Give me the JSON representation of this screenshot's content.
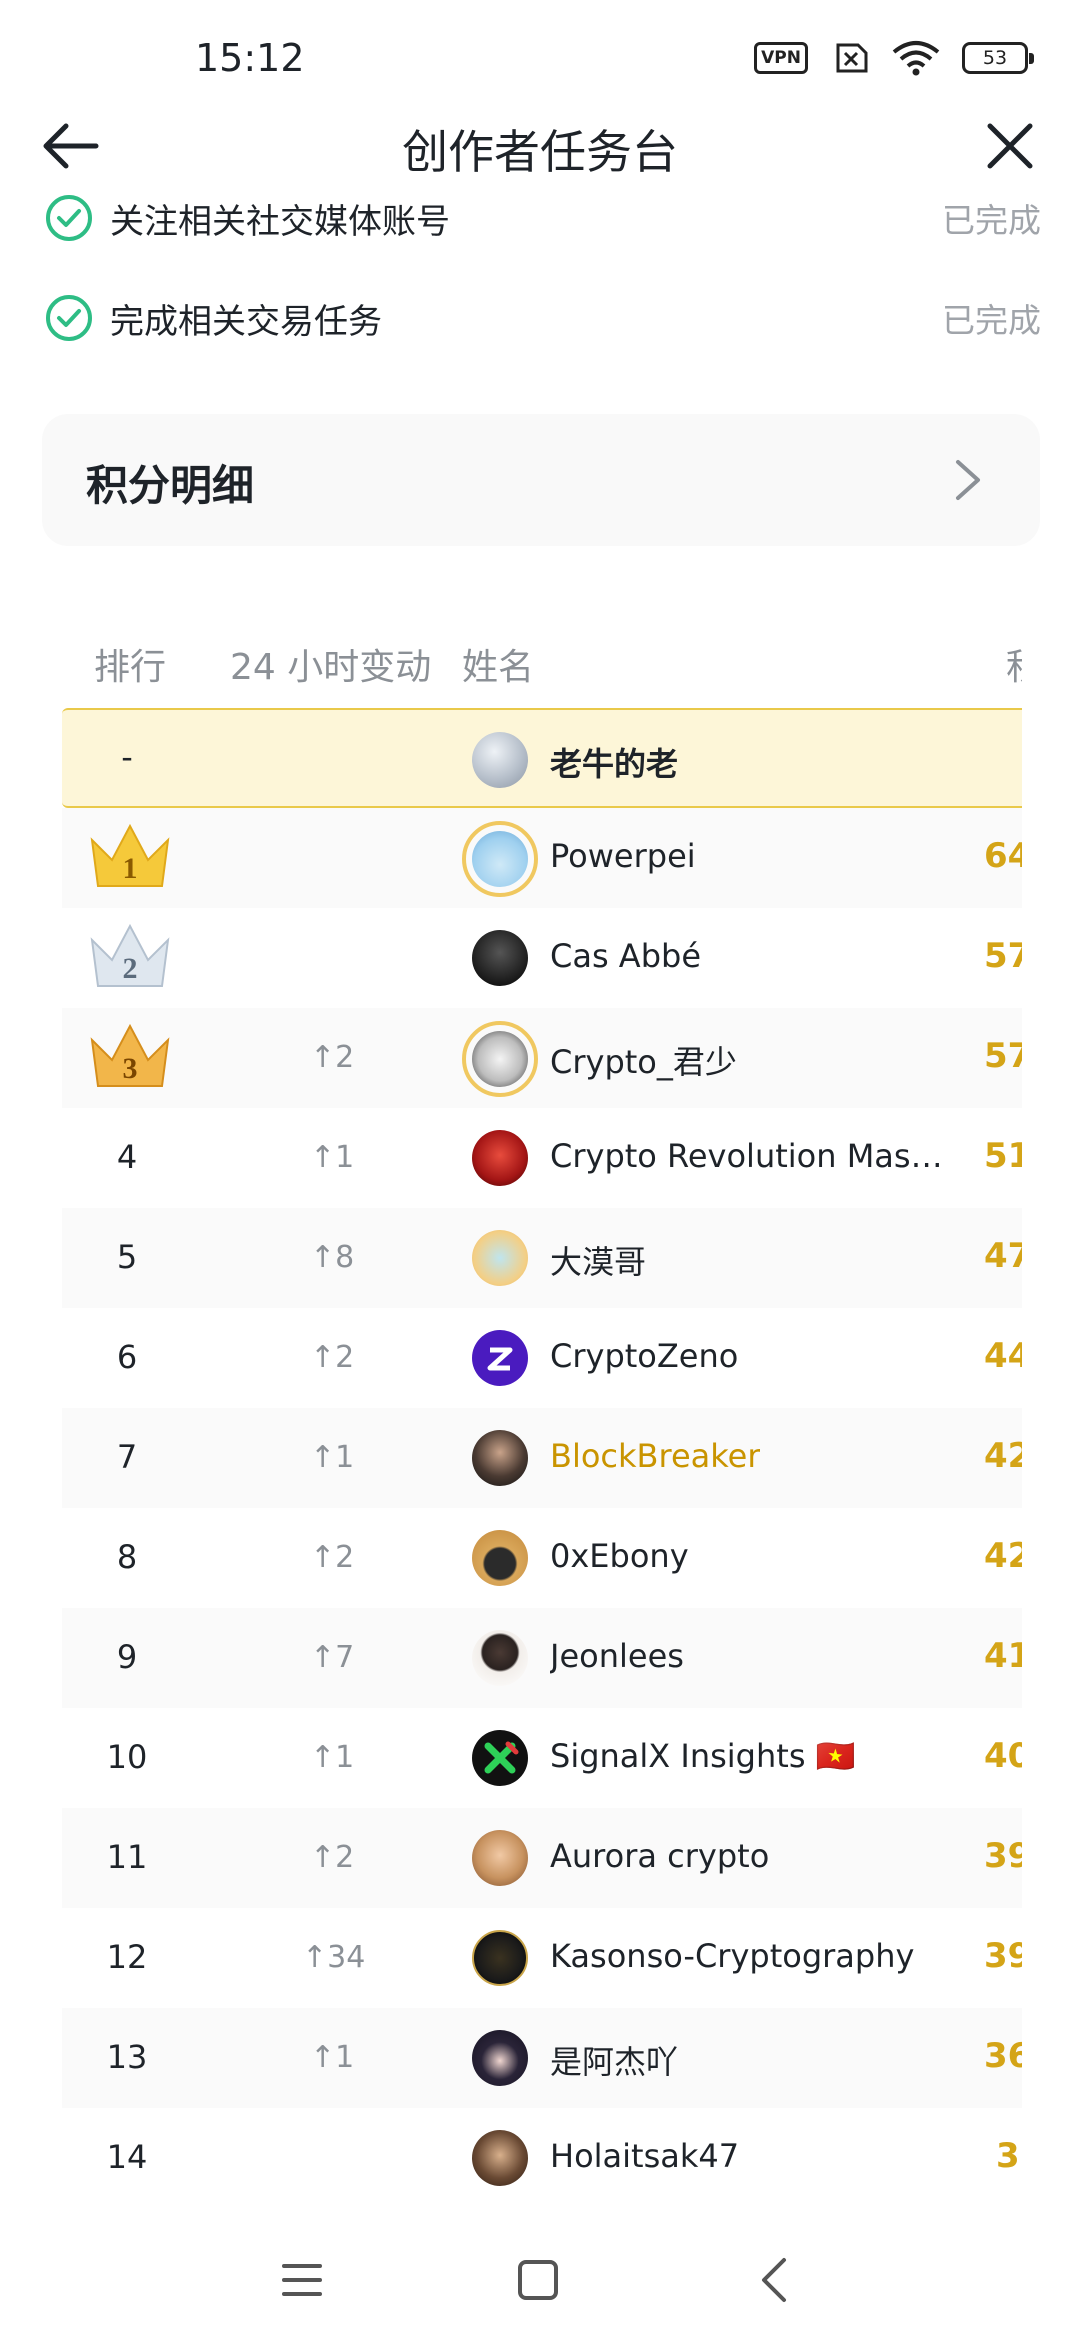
{
  "status_bar": {
    "time": "15:12",
    "vpn_label": "VPN",
    "battery": "53",
    "icons": [
      "vpn-icon",
      "no-sim-icon",
      "wifi-icon",
      "battery-icon"
    ]
  },
  "header": {
    "title": "创作者任务台",
    "back_icon": "arrow-left-icon",
    "close_icon": "close-icon"
  },
  "tasks": [
    {
      "label": "关注相关社交媒体账号",
      "status": "已完成"
    },
    {
      "label": "完成相关交易任务",
      "status": "已完成"
    }
  ],
  "points_card": {
    "title": "积分明细",
    "icon": "chevron-right-icon"
  },
  "leaderboard": {
    "columns": [
      "排行",
      "24 小时变动",
      "姓名",
      "积"
    ],
    "me": {
      "rank": "-",
      "change": "",
      "name": "老牛的老",
      "points": ""
    },
    "rows": [
      {
        "rank": "1",
        "change": "",
        "name": "Powerpei",
        "points": "64"
      },
      {
        "rank": "2",
        "change": "",
        "name": "Cas Abbé",
        "points": "57"
      },
      {
        "rank": "3",
        "change": "↑2",
        "name": "Crypto_君少",
        "points": "57"
      },
      {
        "rank": "4",
        "change": "↑1",
        "name": "Crypto Revolution Mast...",
        "points": "51"
      },
      {
        "rank": "5",
        "change": "↑8",
        "name": "大漠哥",
        "points": "47"
      },
      {
        "rank": "6",
        "change": "↑2",
        "name": "CryptoZeno",
        "points": "44"
      },
      {
        "rank": "7",
        "change": "↑1",
        "name": "BlockBreaker",
        "points": "42"
      },
      {
        "rank": "8",
        "change": "↑2",
        "name": "0xEbony",
        "points": "42"
      },
      {
        "rank": "9",
        "change": "↑7",
        "name": "Jeonlees",
        "points": "41"
      },
      {
        "rank": "10",
        "change": "↑1",
        "name": "SignalX Insights 🇻🇳",
        "points": "40"
      },
      {
        "rank": "11",
        "change": "↑2",
        "name": "Aurora crypto",
        "points": "39"
      },
      {
        "rank": "12",
        "change": "↑34",
        "name": "Kasonso-Cryptography",
        "points": "39"
      },
      {
        "rank": "13",
        "change": "↑1",
        "name": "是阿杰吖",
        "points": "36"
      },
      {
        "rank": "14",
        "change": "",
        "name": "Holaitsak47",
        "points": "3"
      }
    ]
  },
  "colors": {
    "accent_gold": "#d4a417",
    "highlight_name": "#c99400",
    "check_green": "#2ebd85",
    "me_row_bg": "#fdf6d8"
  },
  "nav_bar": {
    "icons": [
      "menu-icon",
      "home-icon",
      "back-icon"
    ]
  }
}
